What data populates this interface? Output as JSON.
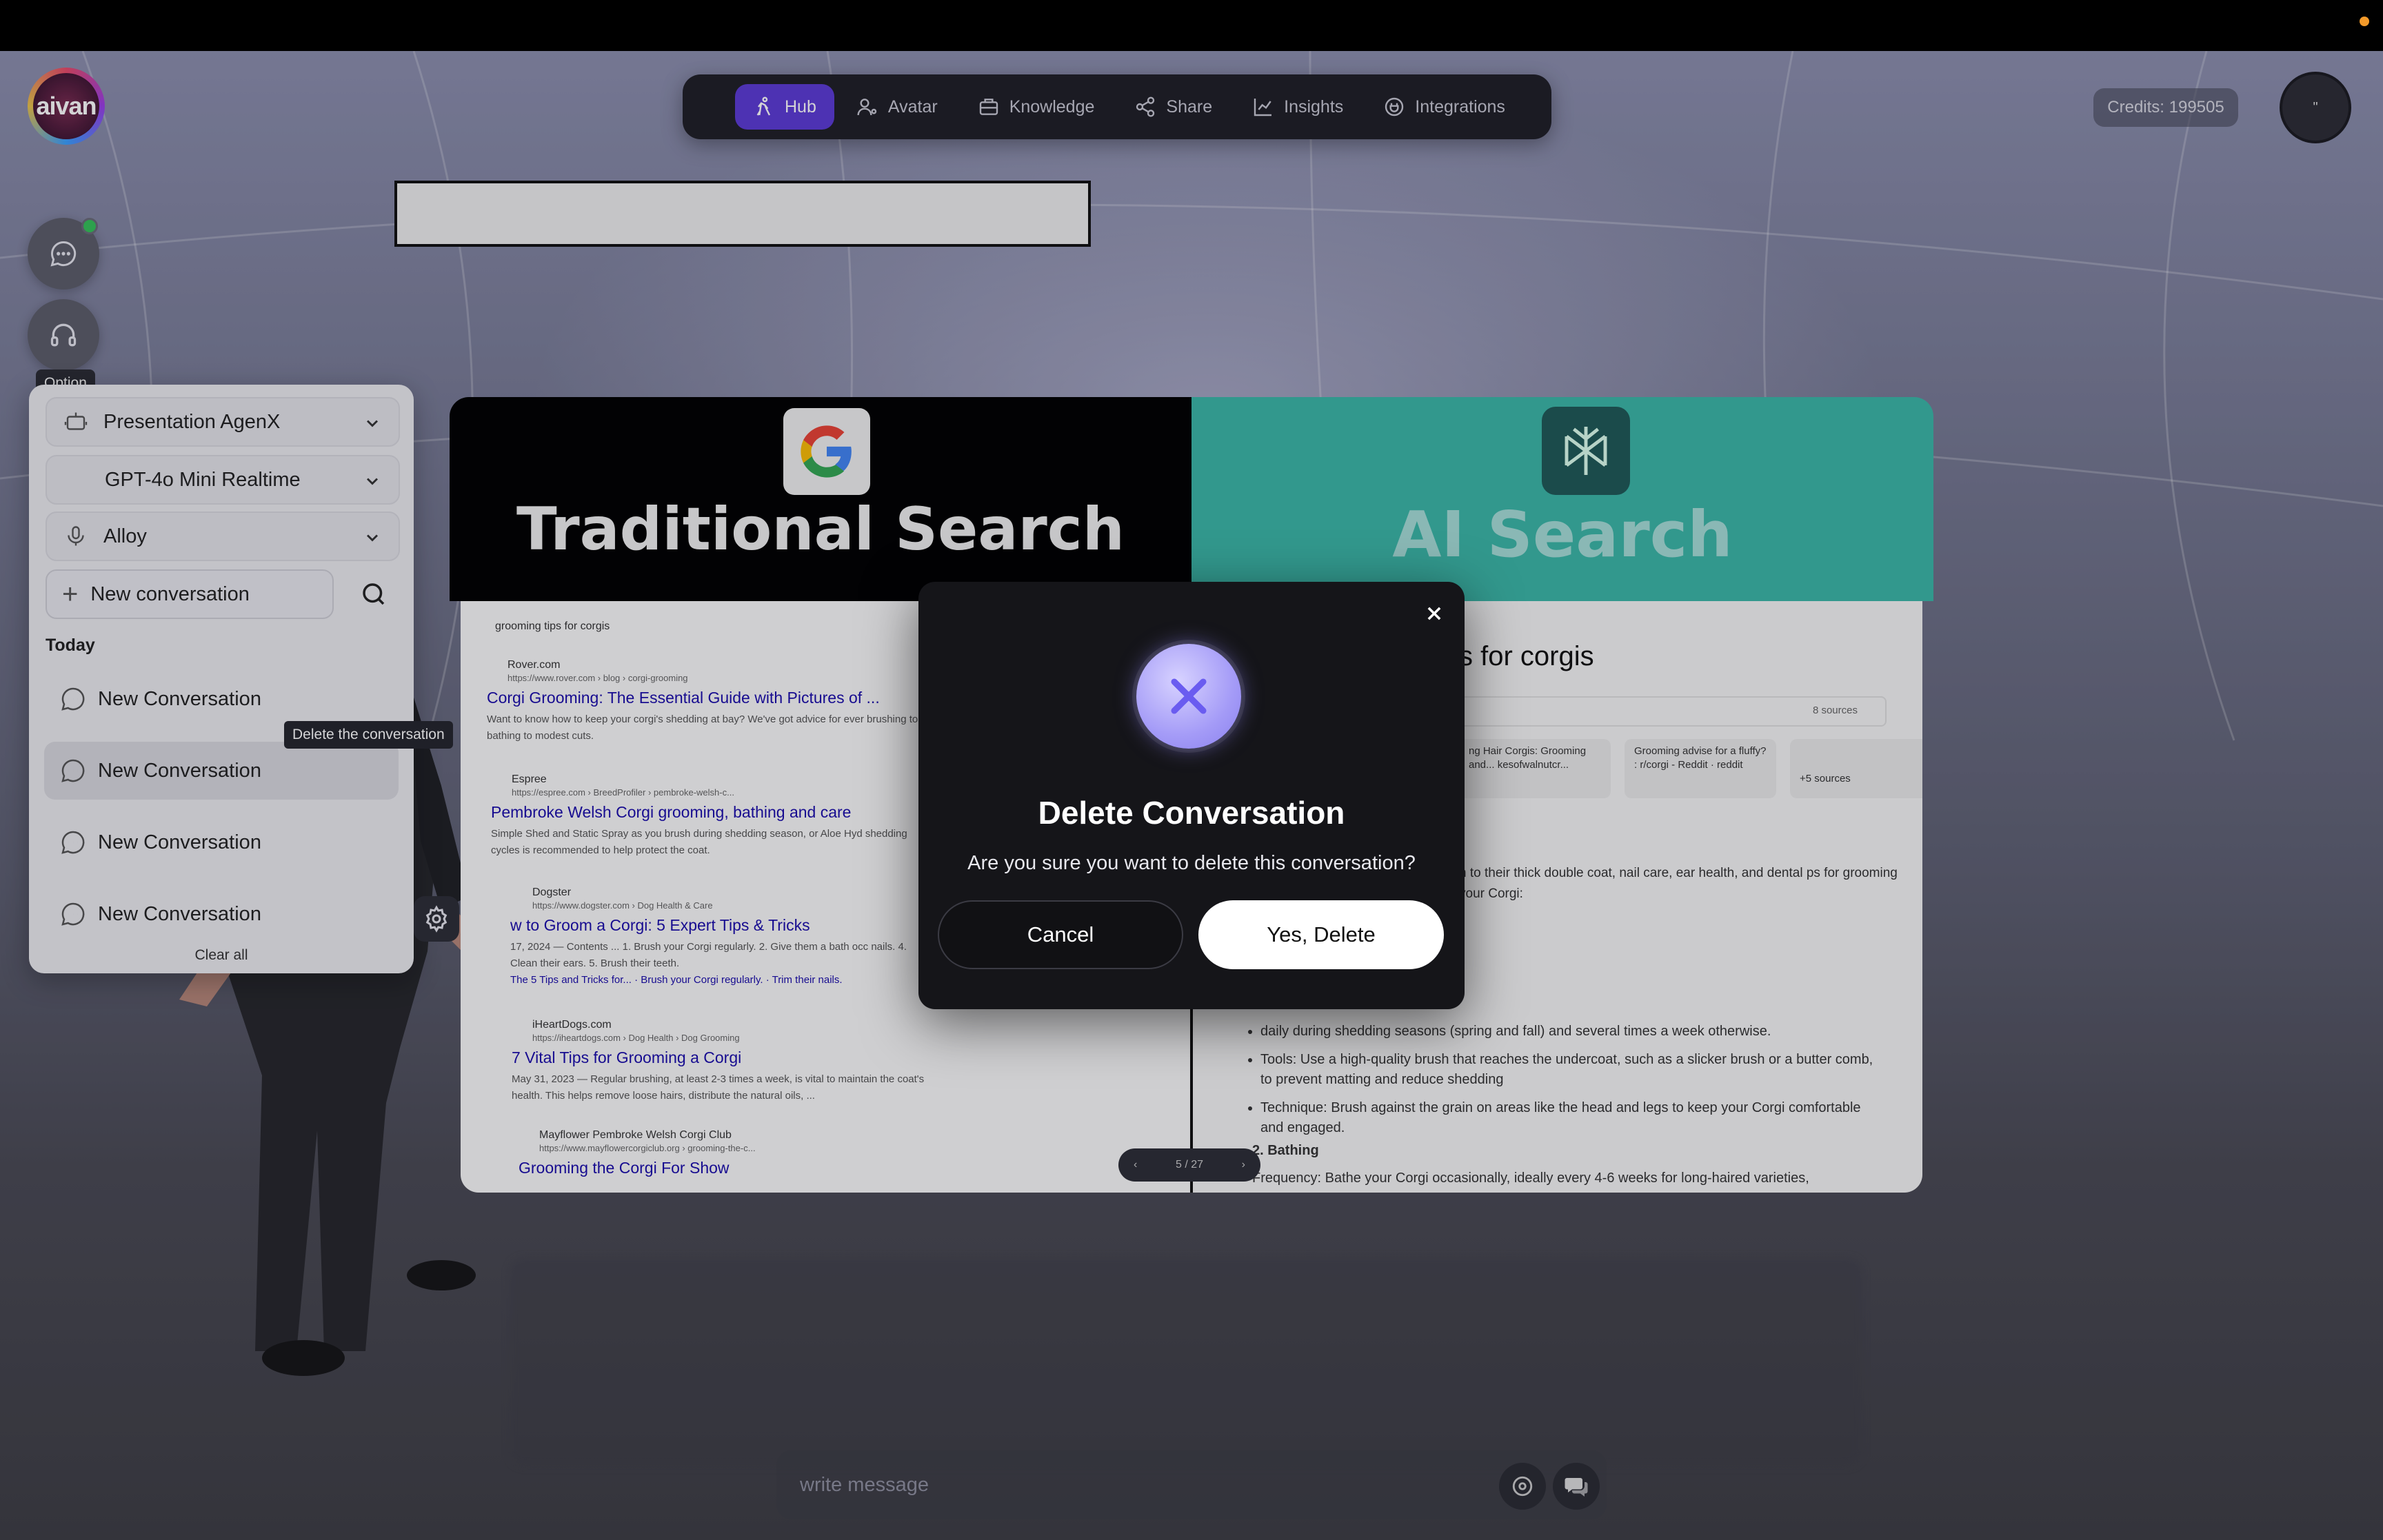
{
  "app": {
    "logo_text": "aivan",
    "credits": "Credits: 199505",
    "user_initials": "\"",
    "accent": "#5c3bd6"
  },
  "nav": {
    "items": [
      {
        "label": "Hub",
        "icon": "person-running-icon",
        "active": true
      },
      {
        "label": "Avatar",
        "icon": "user-gear-icon"
      },
      {
        "label": "Knowledge",
        "icon": "briefcase-icon"
      },
      {
        "label": "Share",
        "icon": "share-icon"
      },
      {
        "label": "Insights",
        "icon": "chart-line-icon"
      },
      {
        "label": "Integrations",
        "icon": "plug-icon"
      }
    ]
  },
  "side": {
    "option_tooltip": "Option"
  },
  "panel": {
    "assistant": "Presentation AgenX",
    "model": "GPT-4o Mini Realtime",
    "voice": "Alloy",
    "new_conversation": "New conversation",
    "today_label": "Today",
    "conversations": [
      "New Conversation",
      "New Conversation",
      "New Conversation",
      "New Conversation"
    ],
    "clear_all": "Clear all",
    "delete_tooltip": "Delete the conversation"
  },
  "slide": {
    "left_title": "Traditional Search",
    "right_title": "AI Search",
    "query": "grooming tips for corgis",
    "results": [
      {
        "site": "Rover.com",
        "url": "https://www.rover.com › blog › corgi-grooming",
        "title": "Corgi Grooming: The Essential Guide with Pictures of ...",
        "snippet": "Want to know how to keep your corgi's shedding at bay? We've got advice for ever brushing to bathing to modest cuts."
      },
      {
        "site": "Espree",
        "url": "https://espree.com › BreedProfiler › pembroke-welsh-c...",
        "title": "Pembroke Welsh Corgi grooming, bathing and care",
        "snippet": "Simple Shed and Static Spray as you brush during shedding season, or Aloe Hyd shedding cycles is recommended to help protect the coat."
      },
      {
        "site": "Dogster",
        "url": "https://www.dogster.com › Dog Health & Care",
        "title": "w to Groom a Corgi: 5 Expert Tips & Tricks",
        "snippet": "17, 2024 — Contents ... 1. Brush your Corgi regularly. 2. Give them a bath occ nails. 4. Clean their ears. 5. Brush their teeth."
      },
      {
        "site": "iHeartDogs.com",
        "url": "https://iheartdogs.com › Dog Health › Dog Grooming",
        "title": "7 Vital Tips for Grooming a Corgi",
        "snippet": "May 31, 2023 — Regular brushing, at least 2-3 times a week, is vital to maintain the coat's health. This helps remove loose hairs, distribute the natural oils, ..."
      },
      {
        "site": "Mayflower Pembroke Welsh Corgi Club",
        "url": "https://www.mayflowercorgiclub.org › grooming-the-c...",
        "title": "Grooming the Corgi For Show",
        "snippet": ""
      }
    ],
    "result_extra": "The 5 Tips and Tricks for... · Brush your Corgi regularly. · Trim their nails.",
    "ai_query_partial": "s for corgis",
    "ai_sources": "8 sources",
    "ai_cards": [
      "ng Hair Corgis: Grooming and... kesofwalnutcr...",
      "Grooming advise for a fluffy? : r/corgi - Reddit · reddit",
      "+5 sources"
    ],
    "ai_intro": "n to their thick double coat, nail care, ear health, and dental ps for grooming your Corgi:",
    "ai_bullets": [
      "daily during shedding seasons (spring and fall) and several times a week otherwise.",
      "Tools: Use a high-quality brush that reaches the undercoat, such as a slicker brush or a butter comb, to prevent matting and reduce shedding",
      "Technique: Brush against the grain on areas like the head and legs to keep your Corgi comfortable and engaged."
    ],
    "ai_section": "2. Bathing",
    "ai_frequency": "Frequency: Bathe your Corgi occasionally, ideally every 4-6 weeks for long-haired varieties,",
    "pager": "5 / 27"
  },
  "modal": {
    "title": "Delete Conversation",
    "message": "Are you sure you want to delete this conversation?",
    "cancel": "Cancel",
    "confirm": "Yes, Delete"
  },
  "composer": {
    "placeholder": "write message"
  }
}
